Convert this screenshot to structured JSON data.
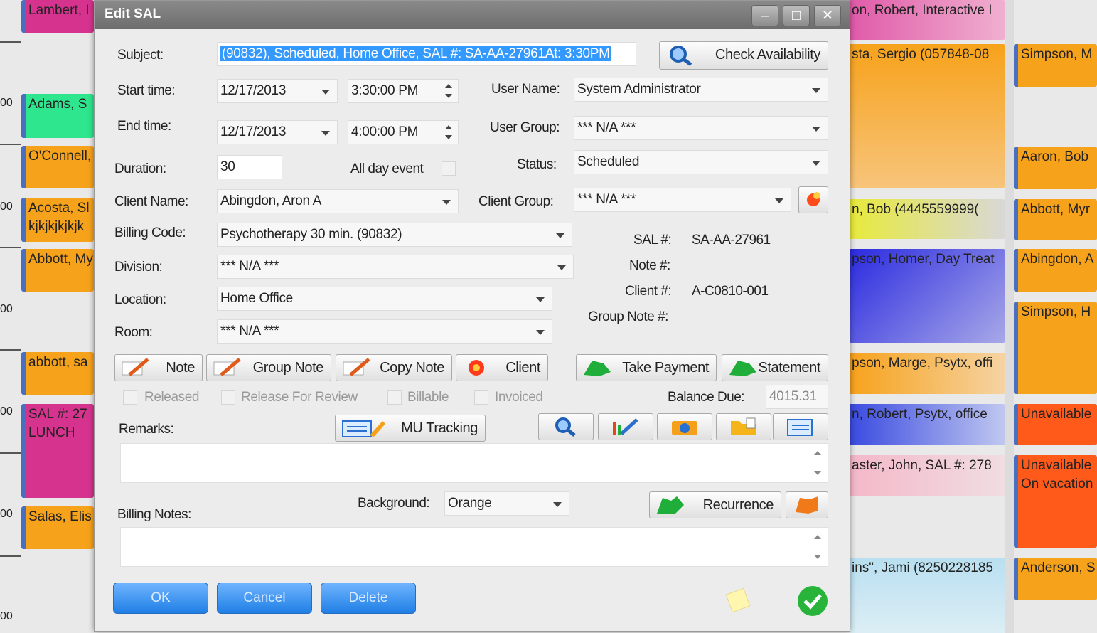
{
  "calendar": {
    "times": [
      "00",
      "00",
      "00",
      "00",
      "00",
      "00",
      "00"
    ],
    "left_col": [
      {
        "text": "Lambert, I",
        "color": "#d6338f"
      },
      {
        "text": "Adams, S",
        "color": "#2ee68e"
      },
      {
        "text": "O'Connell,",
        "color": "#f7a21b"
      },
      {
        "text": "Acosta, Sl kjkjkjkjkjk",
        "color": "#f7a21b"
      },
      {
        "text": "Abbott, My",
        "color": "#f7a21b"
      },
      {
        "text": "abbott, sa",
        "color": "#f7a21b"
      },
      {
        "text": "SAL #: 27 LUNCH",
        "color": "#d6338f"
      },
      {
        "text": "Salas, Elis",
        "color": "#f7a21b"
      }
    ],
    "mid_col": [
      {
        "text": "on, Robert, Interactive I",
        "color": "#e05aa8"
      },
      {
        "text": "sta, Sergio (057848-08",
        "color": "#f7a21b"
      },
      {
        "text": "n, Bob (4445559999(",
        "color": "#e8ea3a"
      },
      {
        "text": "pson, Homer, Day Treat",
        "color": "#3a3ae8"
      },
      {
        "text": "pson, Marge, Psytx, offi",
        "color": "#f7a21b"
      },
      {
        "text": "n, Robert, Psytx, office",
        "color": "#3a4ae0"
      },
      {
        "text": "aster, John, SAL #: 278",
        "color": "#f4b8c8"
      },
      {
        "text": "ins\", Jami (8250228185",
        "color": "#b8dff0"
      }
    ],
    "right_col": [
      {
        "text": "Simpson, M",
        "color": "#f7a21b"
      },
      {
        "text": "Aaron, Bob",
        "color": "#f7a21b"
      },
      {
        "text": "Abbott, Myr",
        "color": "#f7a21b"
      },
      {
        "text": "Abingdon, A",
        "color": "#f7a21b"
      },
      {
        "text": "Simpson, H",
        "color": "#f7a21b"
      },
      {
        "text": "Unavailable",
        "color": "#ff5a1a"
      },
      {
        "text": "Unavailable On vacation",
        "color": "#ff5a1a"
      },
      {
        "text": "Anderson, S",
        "color": "#f7a21b"
      }
    ]
  },
  "dialog": {
    "title": "Edit SAL",
    "subject_label": "Subject:",
    "subject_value": "(90832), Scheduled, Home Office, SAL #: SA-AA-27961At: 3:30PM",
    "check_availability": "Check Availability",
    "start_time_label": "Start time:",
    "start_date": "12/17/2013",
    "start_time": "3:30:00 PM",
    "end_time_label": "End time:",
    "end_date": "12/17/2013",
    "end_time": "4:00:00 PM",
    "duration_label": "Duration:",
    "duration_value": "30",
    "all_day_label": "All day event",
    "user_name_label": "User Name:",
    "user_name_value": "System Administrator",
    "user_group_label": "User Group:",
    "user_group_value": "*** N/A ***",
    "status_label": "Status:",
    "status_value": "Scheduled",
    "client_name_label": "Client Name:",
    "client_name_value": "Abingdon, Aron A",
    "client_group_label": "Client Group:",
    "client_group_value": "*** N/A ***",
    "billing_code_label": "Billing Code:",
    "billing_code_value": "Psychotherapy 30 min.  (90832)",
    "division_label": "Division:",
    "division_value": "*** N/A ***",
    "location_label": "Location:",
    "location_value": "Home Office",
    "room_label": "Room:",
    "room_value": "*** N/A ***",
    "sal_label": "SAL #:",
    "sal_value": "SA-AA-27961",
    "note_label": "Note #:",
    "note_value": "",
    "client_num_label": "Client #:",
    "client_num_value": "A-C0810-001",
    "group_note_label": "Group Note #:",
    "group_note_value": "",
    "btn_note": "Note",
    "btn_group_note": "Group Note",
    "btn_copy_note": "Copy Note",
    "btn_client": "Client",
    "btn_take_payment": "Take Payment",
    "btn_statement": "Statement",
    "released": "Released",
    "release_for_review": "Release For Review",
    "billable": "Billable",
    "invoiced": "Invoiced",
    "balance_due_label": "Balance Due:",
    "balance_due_value": "4015.31",
    "remarks_label": "Remarks:",
    "mu_tracking": "MU Tracking",
    "billing_notes_label": "Billing Notes:",
    "background_label": "Background:",
    "background_value": "Orange",
    "recurrence": "Recurrence",
    "ok": "OK",
    "cancel": "Cancel",
    "delete": "Delete"
  },
  "colors": {
    "accent_blue": "#1f7fe5",
    "selection": "#3399ff",
    "titlebar": "#7a7a7a"
  }
}
